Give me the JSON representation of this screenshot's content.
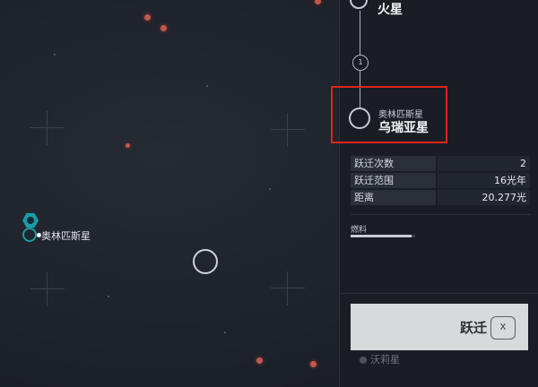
{
  "map": {
    "current_planet_label": "奥林匹斯星"
  },
  "route": {
    "origin_name": "火星",
    "jump_count_badge": "1",
    "target_subtitle": "奥林匹斯星",
    "target_name": "乌瑞亚星"
  },
  "stats": [
    {
      "label": "跃迁次数",
      "value": "2"
    },
    {
      "label": "跃迁范围",
      "value": "16光年"
    },
    {
      "label": "距离",
      "value": "20.277光"
    }
  ],
  "fuel": {
    "label": "燃料",
    "level_fraction": 0.95
  },
  "jump_button": {
    "label": "跃迁",
    "key": "X"
  },
  "bottom": {
    "item_label": "沃莉星"
  },
  "colors": {
    "highlight": "#e0231c",
    "accent": "#1b9aa7",
    "planet_red": "#c2584e"
  }
}
